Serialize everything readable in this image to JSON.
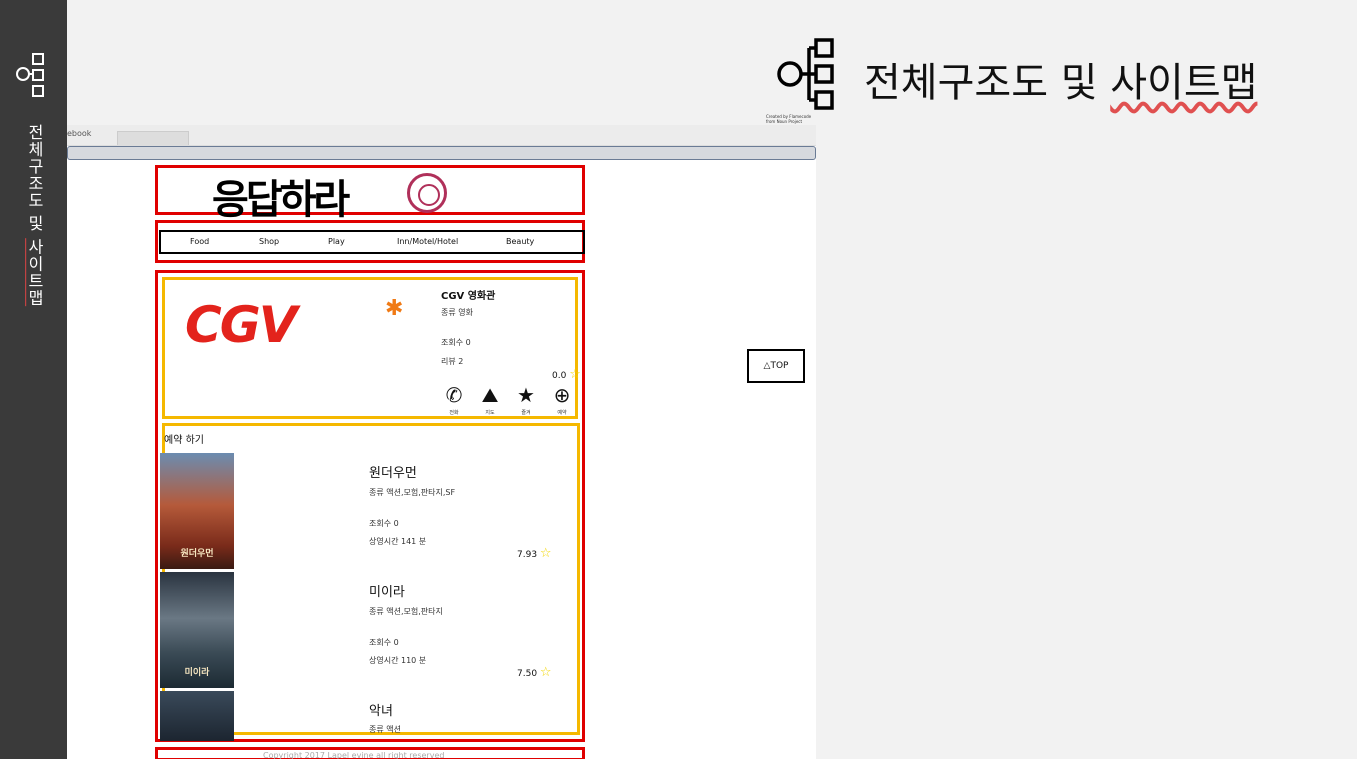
{
  "slide": {
    "title_prefix": "전체구조도 및 ",
    "title_underlined": "사이트맵",
    "credit_line1": "Created by Flamecode",
    "credit_line2": "from Noun Project"
  },
  "sidebar": {
    "title_prefix": "전체구조도 및 ",
    "title_underlined": "사이트맵"
  },
  "browser": {
    "tab_label": "ebook"
  },
  "site": {
    "logo_text": "응답하라",
    "nav": [
      "Food",
      "Shop",
      "Play",
      "Inn/Motel/Hotel",
      "Beauty"
    ],
    "top_button": "△TOP",
    "copyright": "Copyright 2017 Lapel evine all right reserved"
  },
  "place": {
    "logo_text": "CGV",
    "name": "CGV 영화관",
    "category": "종류   영화",
    "views": "조회수   0",
    "reviews": "리뷰   2",
    "rating": "0.0",
    "actions": [
      {
        "icon": "phone-icon",
        "label": "전화"
      },
      {
        "icon": "map-icon",
        "label": "지도"
      },
      {
        "icon": "star-icon",
        "label": "즐겨"
      },
      {
        "icon": "add-user-icon",
        "label": "예약"
      }
    ]
  },
  "reservation": {
    "heading": "예약 하기",
    "movies": [
      {
        "title": "원더우먼",
        "genre": "종류   액션,모험,판타지,SF",
        "views": "조회수   0",
        "runtime": "상영시간   141 분",
        "rating": "7.93",
        "poster_caption": "원더우먼"
      },
      {
        "title": "미이라",
        "genre": "종류   액션,모험,판타지",
        "views": "조회수   0",
        "runtime": "상영시간   110 분",
        "rating": "7.50",
        "poster_caption": "미이라"
      },
      {
        "title": "악녀",
        "genre": "종류   액션",
        "views": "",
        "runtime": "",
        "rating": "",
        "poster_caption": ""
      }
    ]
  },
  "colors": {
    "highlight_red": "#e00000",
    "highlight_yellow": "#f5b800",
    "sidebar": "#3a3a3a",
    "cgv_red": "#e3231c"
  }
}
